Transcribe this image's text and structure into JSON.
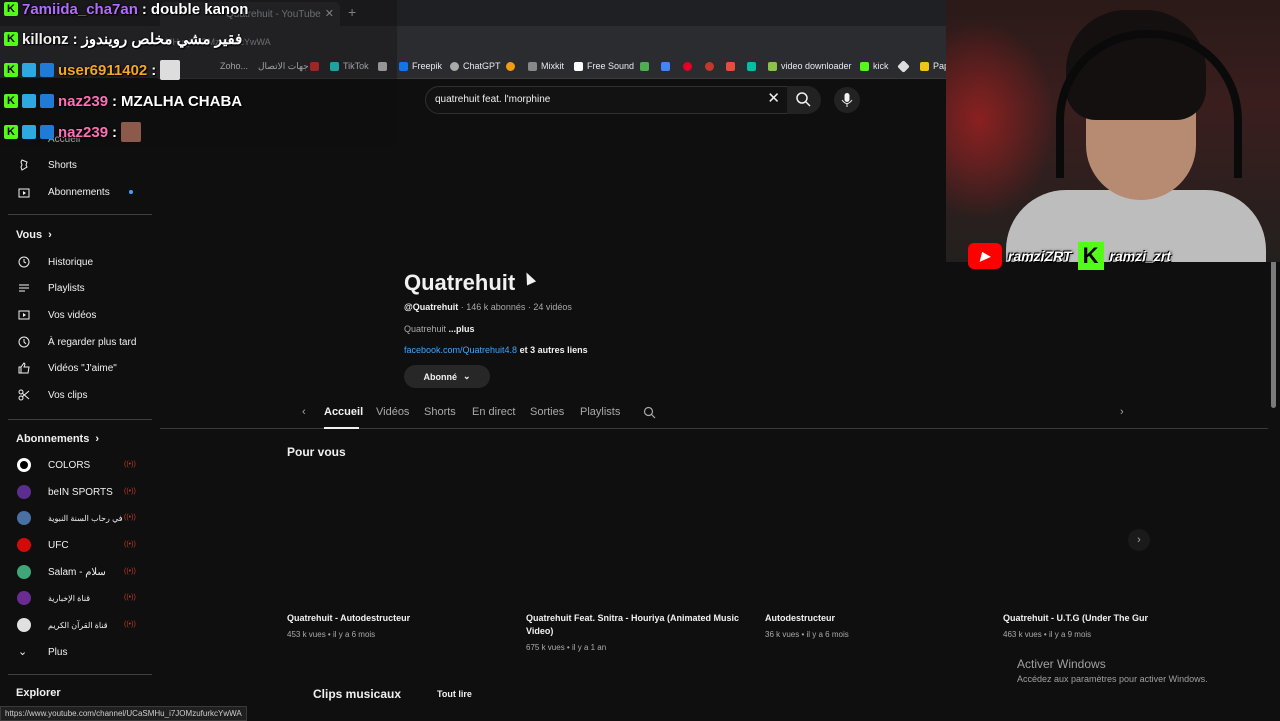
{
  "browser": {
    "tab_title": "Quatrehuit - YouTube",
    "url_fragment": "MHu_i7JOMzufurkcYwWA",
    "bookmarks": [
      "Zoho...",
      "جهات الاتصال",
      "TikTok",
      "Freepik",
      "ChatGPT",
      "Mixkit",
      "Free Sound",
      "video downloader",
      "kick",
      "Pap"
    ]
  },
  "search": {
    "query": "quatrehuit feat. l'morphine"
  },
  "sidebar": {
    "top_items": [
      {
        "label": "Accueil",
        "icon": "home-icon"
      },
      {
        "label": "Shorts",
        "icon": "shorts-icon"
      },
      {
        "label": "Abonnements",
        "icon": "subscriptions-icon"
      }
    ],
    "you_header": "Vous",
    "you_items": [
      {
        "label": "Historique",
        "icon": "history-icon"
      },
      {
        "label": "Playlists",
        "icon": "playlists-icon"
      },
      {
        "label": "Vos vidéos",
        "icon": "your-videos-icon"
      },
      {
        "label": "À regarder plus tard",
        "icon": "watch-later-icon"
      },
      {
        "label": "Vidéos \"J'aime\"",
        "icon": "thumbs-up-icon"
      },
      {
        "label": "Vos clips",
        "icon": "scissors-icon"
      }
    ],
    "subs_header": "Abonnements",
    "subscriptions": [
      {
        "label": "COLORS",
        "color": "#ffffff"
      },
      {
        "label": "beIN SPORTS",
        "color": "#5b2d8e"
      },
      {
        "label": "في رحاب السنة النبوية",
        "color": "#4a6fa5"
      },
      {
        "label": "UFC",
        "color": "#d20a0a"
      },
      {
        "label": "Salam - سلام",
        "color": "#3fa67a"
      },
      {
        "label": "قناة الإخبارية",
        "color": "#6a2c91"
      },
      {
        "label": "قناة القرآن الكريم",
        "color": "#e0e0e0"
      }
    ],
    "more_label": "Plus",
    "explore_header": "Explorer"
  },
  "channel": {
    "name": "Quatrehuit",
    "handle": "@Quatrehuit",
    "subscribers": "146 k abonnés",
    "videos_count": "24 vidéos",
    "description": "Quatrehuit",
    "more": "...plus",
    "link": "facebook.com/Quatrehuit4.8",
    "other_links": "et 3 autres liens",
    "subscribe_label": "Abonné"
  },
  "tabs": [
    "Accueil",
    "Vidéos",
    "Shorts",
    "En direct",
    "Sorties",
    "Playlists"
  ],
  "section": {
    "title": "Pour vous"
  },
  "videos": [
    {
      "title": "Quatrehuit - Autodestructeur",
      "meta": "453 k vues • il y a 6 mois"
    },
    {
      "title": "Quatrehuit Feat. Snitra - Houriya (Animated Music Video)",
      "meta": "675 k vues • il y a 1 an"
    },
    {
      "title": "Autodestructeur",
      "meta": "36 k vues • il y a 6 mois"
    },
    {
      "title": "Quatrehuit - U.T.G (Under The Gun",
      "meta": "463 k vues • il y a 9 mois"
    }
  ],
  "clips": {
    "title": "Clips musicaux",
    "play_all": "Tout lire"
  },
  "windows": {
    "line1": "Activer Windows",
    "line2": "Accédez aux paramètres pour activer Windows."
  },
  "status_url": "https://www.youtube.com/channel/UCaSMHu_i7JOMzufurkcYwWA",
  "chat": [
    {
      "user": "7amiida_cha7an",
      "msg": "double kanon",
      "user_color": "#b46bff"
    },
    {
      "user": "killonz",
      "msg": "فقير مشي مخلص رويندوز",
      "user_color": "#f1f1f1"
    },
    {
      "user": "user6911402",
      "msg": "",
      "user_color": "#f5a623"
    },
    {
      "user": "naz239",
      "msg": "MZALHA CHABA",
      "user_color": "#ff6fb5"
    },
    {
      "user": "naz239",
      "msg": "",
      "user_color": "#ff6fb5"
    }
  ],
  "socials": {
    "youtube": "ramziZRT",
    "kick": "ramzi_zrt"
  }
}
